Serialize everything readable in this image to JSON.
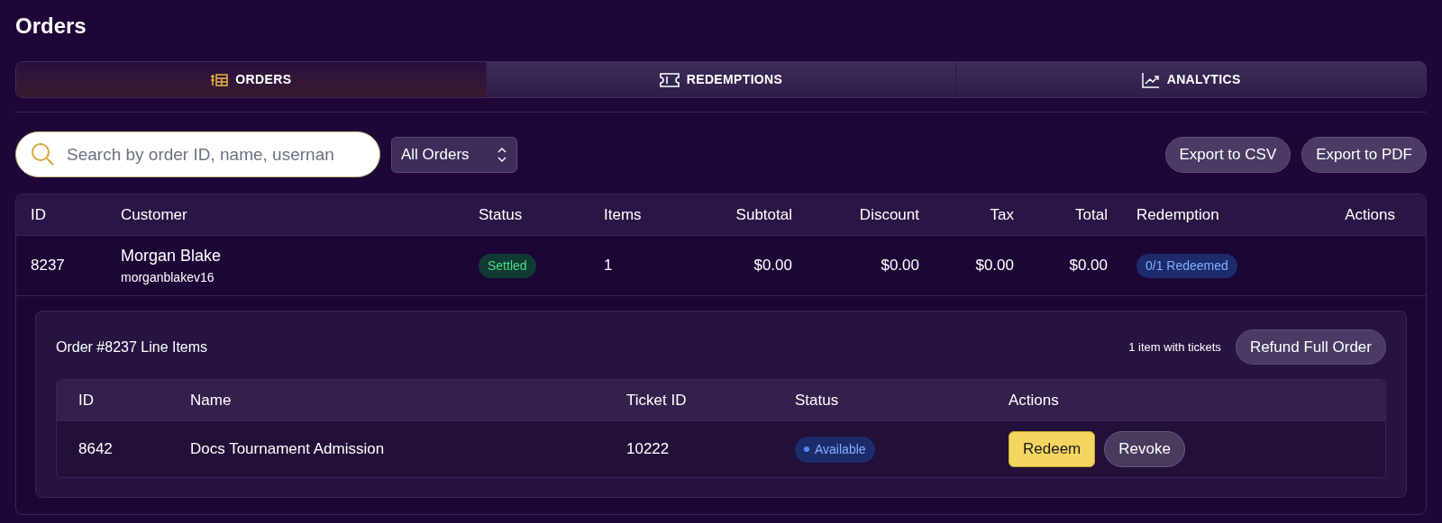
{
  "page_title": "Orders",
  "tabs": [
    {
      "label": "ORDERS",
      "selected": true
    },
    {
      "label": "REDEMPTIONS",
      "selected": false
    },
    {
      "label": "ANALYTICS",
      "selected": false
    }
  ],
  "search": {
    "placeholder": "Search by order ID, name, usernan"
  },
  "filter": {
    "value": "All Orders"
  },
  "export_buttons": [
    "Export to CSV",
    "Export to PDF"
  ],
  "orders_table": {
    "columns": [
      "ID",
      "Customer",
      "Status",
      "Items",
      "Subtotal",
      "Discount",
      "Tax",
      "Total",
      "Redemption",
      "Actions"
    ],
    "rows": [
      {
        "id": "8237",
        "customer_name": "Morgan Blake",
        "username": "morganblakev16",
        "status": {
          "label": "Settled",
          "kind": "success"
        },
        "items": "1",
        "subtotal": "$0.00",
        "discount": "$0.00",
        "tax": "$0.00",
        "total": "$0.00",
        "redemption": "0/1 Redeemed",
        "expanded": true,
        "detail": {
          "title": "Order #8237 Line Items",
          "summary": "1 item with tickets",
          "refund_button": "Refund Full Order",
          "columns": [
            "ID",
            "Name",
            "Ticket ID",
            "Status",
            "Actions"
          ],
          "rows": [
            {
              "id": "8642",
              "name": "Docs Tournament Admission",
              "ticket_id": "10222",
              "status": {
                "label": "Available",
                "kind": "info"
              },
              "actions": [
                {
                  "label": "Redeem",
                  "kind": "primary"
                },
                {
                  "label": "Revoke",
                  "kind": "secondary"
                }
              ]
            }
          ]
        }
      }
    ]
  }
}
